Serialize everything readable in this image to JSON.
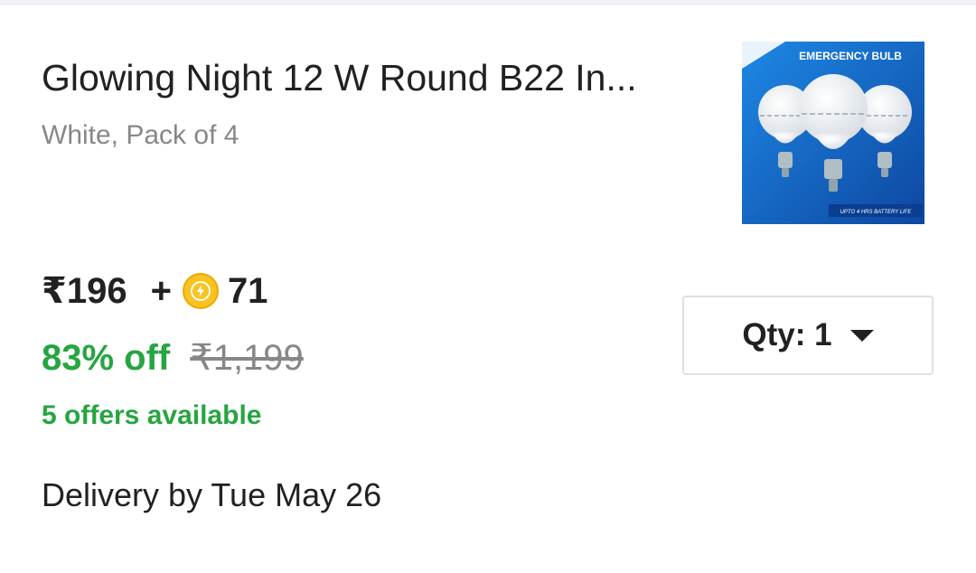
{
  "product": {
    "title": "Glowing Night 12 W Round B22 In...",
    "variant": "White, Pack of 4",
    "image": {
      "banner_text": "EMERGENCY BULB",
      "footer_text": "UPTO 4 HRS BATTERY LIFE"
    }
  },
  "pricing": {
    "price": "₹196",
    "plus": "+",
    "coins": "71",
    "coin_icon": "supercoin-lightning-icon",
    "discount": "83% off",
    "mrp": "₹1,199"
  },
  "offers": {
    "label": "5 offers available"
  },
  "delivery": {
    "text": "Delivery by Tue May 26"
  },
  "quantity": {
    "label": "Qty: 1"
  },
  "colors": {
    "green": "#26a541",
    "grey": "#878787",
    "text": "#212121",
    "coin": "#f7c422"
  }
}
